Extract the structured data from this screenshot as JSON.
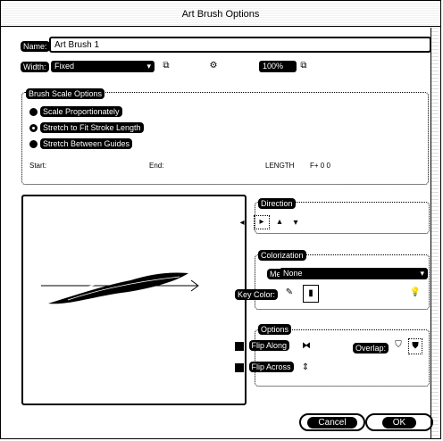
{
  "window": {
    "title": "Art Brush Options"
  },
  "name": {
    "label": "Name:",
    "value": "Art Brush 1"
  },
  "width": {
    "label": "Width:",
    "value": "Fixed",
    "percent": "100%"
  },
  "brush_scale": {
    "legend": "Brush Scale Options",
    "options": [
      {
        "label": "Scale Proportionately",
        "selected": false
      },
      {
        "label": "Stretch to Fit Stroke Length",
        "selected": true
      },
      {
        "label": "Stretch Between Guides",
        "selected": false
      }
    ],
    "start": "Start:",
    "end": "End:",
    "length_value": "LENGTH",
    "small_value": "F+ 0 0"
  },
  "direction": {
    "legend": "Direction"
  },
  "colorization": {
    "legend": "Colorization",
    "method_label": "Method:",
    "method_value": "None",
    "key_color_label": "Key Color:"
  },
  "options": {
    "legend": "Options",
    "flip_along": "Flip Along",
    "flip_across": "Flip Across",
    "overlap_label": "Overlap:"
  },
  "buttons": {
    "cancel": "Cancel",
    "ok": "OK"
  },
  "colors": {
    "primary": "#000000",
    "background": "#ffffff"
  },
  "icons": [
    "link-icon",
    "settings-icon",
    "lightbulb-icon",
    "eyedropper-icon",
    "flip-along-icon",
    "flip-across-icon"
  ]
}
